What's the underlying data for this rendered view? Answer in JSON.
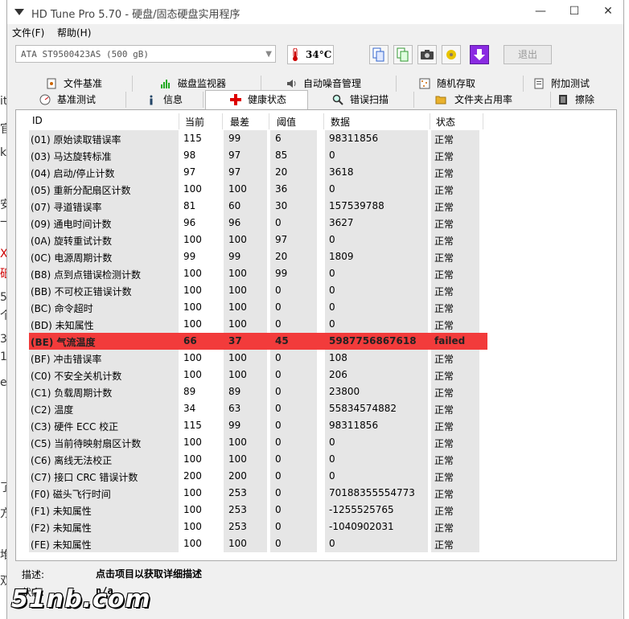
{
  "window": {
    "title": "HD Tune Pro 5.70 - 硬盘/固态硬盘实用程序",
    "minimize": "—",
    "maximize": "☐",
    "close": "✕"
  },
  "menu": [
    "文件(F)",
    "帮助(H)"
  ],
  "toolbar": {
    "drive": "ATA    ST9500423AS (500 gB)",
    "temperature": "34°C",
    "exit_label": "退出"
  },
  "tabs_top": [
    "文件基准",
    "磁盘监视器",
    "自动噪音管理",
    "随机存取",
    "附加测试"
  ],
  "tabs_bottom": [
    "基准测试",
    "信息",
    "健康状态",
    "错误扫描",
    "文件夹占用率",
    "擦除"
  ],
  "active_tab": "健康状态",
  "columns": [
    "ID",
    "当前",
    "最差",
    "阈值",
    "数据",
    "状态"
  ],
  "rows": [
    {
      "id": "(01) 原始读取错误率",
      "cur": "115",
      "worst": "99",
      "thr": "6",
      "data": "98311856",
      "status": "正常"
    },
    {
      "id": "(03) 马达旋转标准",
      "cur": "98",
      "worst": "97",
      "thr": "85",
      "data": "0",
      "status": "正常"
    },
    {
      "id": "(04) 启动/停止计数",
      "cur": "97",
      "worst": "97",
      "thr": "20",
      "data": "3618",
      "status": "正常"
    },
    {
      "id": "(05) 重新分配扇区计数",
      "cur": "100",
      "worst": "100",
      "thr": "36",
      "data": "0",
      "status": "正常"
    },
    {
      "id": "(07) 寻道错误率",
      "cur": "81",
      "worst": "60",
      "thr": "30",
      "data": "157539788",
      "status": "正常"
    },
    {
      "id": "(09) 通电时间计数",
      "cur": "96",
      "worst": "96",
      "thr": "0",
      "data": "3627",
      "status": "正常"
    },
    {
      "id": "(0A) 旋转重试计数",
      "cur": "100",
      "worst": "100",
      "thr": "97",
      "data": "0",
      "status": "正常"
    },
    {
      "id": "(0C) 电源周期计数",
      "cur": "99",
      "worst": "99",
      "thr": "20",
      "data": "1809",
      "status": "正常"
    },
    {
      "id": "(B8) 点到点错误检测计数",
      "cur": "100",
      "worst": "100",
      "thr": "99",
      "data": "0",
      "status": "正常"
    },
    {
      "id": "(BB) 不可校正错误计数",
      "cur": "100",
      "worst": "100",
      "thr": "0",
      "data": "0",
      "status": "正常"
    },
    {
      "id": "(BC) 命令超时",
      "cur": "100",
      "worst": "100",
      "thr": "0",
      "data": "0",
      "status": "正常"
    },
    {
      "id": "(BD) 未知属性",
      "cur": "100",
      "worst": "100",
      "thr": "0",
      "data": "0",
      "status": "正常"
    },
    {
      "id": "(BE) 气流温度",
      "cur": "66",
      "worst": "37",
      "thr": "45",
      "data": "5987756867618",
      "status": "failed",
      "failed": true
    },
    {
      "id": "(BF) 冲击错误率",
      "cur": "100",
      "worst": "100",
      "thr": "0",
      "data": "108",
      "status": "正常"
    },
    {
      "id": "(C0) 不安全关机计数",
      "cur": "100",
      "worst": "100",
      "thr": "0",
      "data": "206",
      "status": "正常"
    },
    {
      "id": "(C1) 负载周期计数",
      "cur": "89",
      "worst": "89",
      "thr": "0",
      "data": "23800",
      "status": "正常"
    },
    {
      "id": "(C2) 温度",
      "cur": "34",
      "worst": "63",
      "thr": "0",
      "data": "55834574882",
      "status": "正常"
    },
    {
      "id": "(C3) 硬件 ECC 校正",
      "cur": "115",
      "worst": "99",
      "thr": "0",
      "data": "98311856",
      "status": "正常"
    },
    {
      "id": "(C5) 当前待映射扇区计数",
      "cur": "100",
      "worst": "100",
      "thr": "0",
      "data": "0",
      "status": "正常"
    },
    {
      "id": "(C6) 离线无法校正",
      "cur": "100",
      "worst": "100",
      "thr": "0",
      "data": "0",
      "status": "正常"
    },
    {
      "id": "(C7) 接口 CRC 错误计数",
      "cur": "200",
      "worst": "200",
      "thr": "0",
      "data": "0",
      "status": "正常"
    },
    {
      "id": "(F0) 磁头飞行时间",
      "cur": "100",
      "worst": "253",
      "thr": "0",
      "data": "70188355554773",
      "status": "正常"
    },
    {
      "id": "(F1) 未知属性",
      "cur": "100",
      "worst": "253",
      "thr": "0",
      "data": "-1255525765",
      "status": "正常"
    },
    {
      "id": "(F2) 未知属性",
      "cur": "100",
      "worst": "253",
      "thr": "0",
      "data": "-1040902031",
      "status": "正常"
    },
    {
      "id": "(FE) 未知属性",
      "cur": "100",
      "worst": "100",
      "thr": "0",
      "data": "0",
      "status": "正常"
    }
  ],
  "footer": {
    "desc_label": "描述:",
    "desc_value": "点击项目以获取详细描述",
    "state_label": "状态:",
    "state_value": "n/a"
  },
  "watermark": "51nb.com",
  "colors": {
    "failed_row": "#f23b3b",
    "shade": "#e6e6e6"
  }
}
